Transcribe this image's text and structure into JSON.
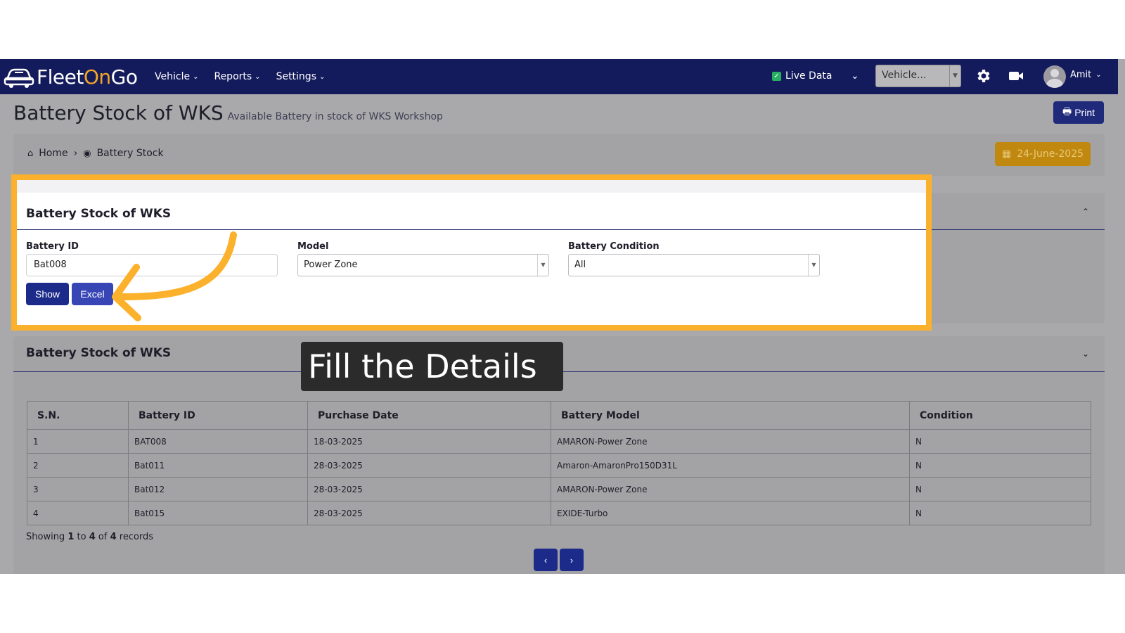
{
  "brand": {
    "fleet": "Fleet",
    "on": "On",
    "go": "Go"
  },
  "nav": {
    "vehicle": "Vehicle",
    "reports": "Reports",
    "settings": "Settings",
    "live_data": "Live Data",
    "vehicle_select": "Vehicle...",
    "user": "Amit"
  },
  "page": {
    "title": "Battery Stock of WKS",
    "subtitle": "Available Battery in stock of WKS Workshop",
    "print": "Print"
  },
  "breadcrumb": {
    "home": "Home",
    "separator": "›",
    "current": "Battery Stock"
  },
  "date": "24-June-2025",
  "filter": {
    "title": "Battery Stock of WKS",
    "battery_id_label": "Battery ID",
    "battery_id_value": "Bat008",
    "model_label": "Model",
    "model_value": "Power Zone",
    "condition_label": "Battery Condition",
    "condition_value": "All",
    "show": "Show",
    "excel": "Excel"
  },
  "tooltip": "Fill the Details",
  "results": {
    "title": "Battery Stock of WKS",
    "columns": [
      "S.N.",
      "Battery ID",
      "Purchase Date",
      "Battery Model",
      "Condition"
    ],
    "rows": [
      [
        "1",
        "BAT008",
        "18-03-2025",
        "AMARON-Power Zone",
        "N"
      ],
      [
        "2",
        "Bat011",
        "28-03-2025",
        "Amaron-AmaronPro150D31L",
        "N"
      ],
      [
        "3",
        "Bat012",
        "28-03-2025",
        "AMARON-Power Zone",
        "N"
      ],
      [
        "4",
        "Bat015",
        "28-03-2025",
        "EXIDE-Turbo",
        "N"
      ]
    ],
    "showing": {
      "prefix": "Showing",
      "from": "1",
      "to_word": "to",
      "to": "4",
      "of_word": "of",
      "total": "4",
      "suffix": "records"
    },
    "prev": "‹",
    "next": "›"
  },
  "colors": {
    "navbar": "#141b5c",
    "highlight": "#fbb12b",
    "primary": "#1c2b8a",
    "date_button": "#c0880e"
  }
}
